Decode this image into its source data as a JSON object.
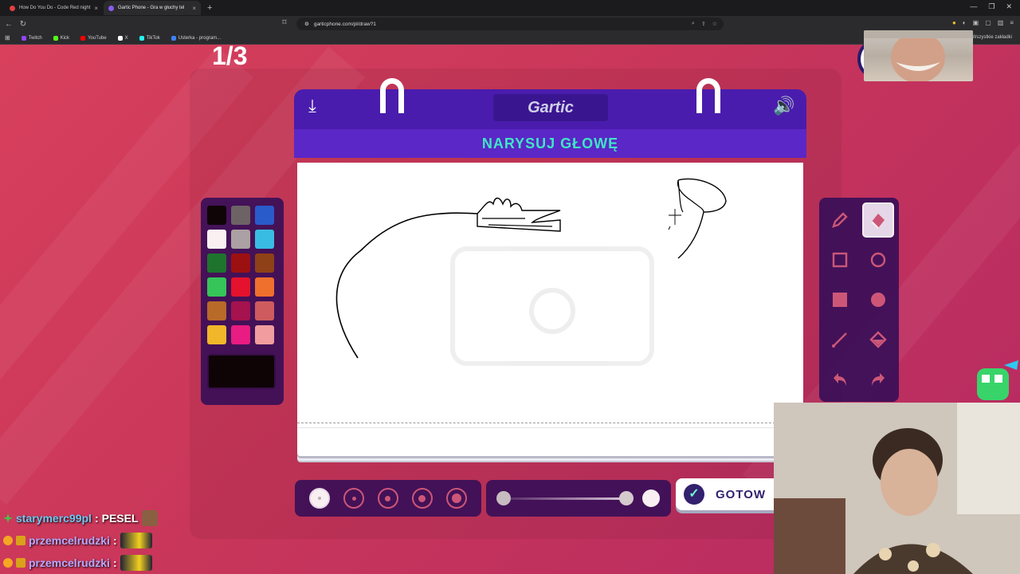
{
  "browser": {
    "tabs": [
      {
        "label": "How Do You Do - Code Red night",
        "active": false,
        "color": "#e34040"
      },
      {
        "label": "Gartic Phone - Gra w głuchy tel",
        "active": true,
        "color": "#8a5cf0"
      }
    ],
    "new_tab": "+",
    "url": "garticphone.com/pl/draw?1",
    "bookmarks": [
      {
        "label": "Twitch",
        "color": "#9146ff"
      },
      {
        "label": "Kick",
        "color": "#53fc18"
      },
      {
        "label": "YouTube",
        "color": "#ff0000"
      },
      {
        "label": "X",
        "color": "#ffffff"
      },
      {
        "label": "TikTok",
        "color": "#25f4ee"
      },
      {
        "label": "Usterka - program...",
        "color": "#3b82f6"
      }
    ],
    "bookmarks_right": "Wszystkie zakładki"
  },
  "game": {
    "round": "1/3",
    "logo": "Gartic",
    "prompt": "NARYSUJ GŁOWĘ",
    "palette": [
      "#000000",
      "#666666",
      "#1d5fd6",
      "#ffffff",
      "#aaaaaa",
      "#2ec8f0",
      "#117a2a",
      "#9a0d0d",
      "#8a4311",
      "#2ad25a",
      "#e8102a",
      "#f4762a",
      "#b86f25",
      "#a3104e",
      "#d06060",
      "#f7c227",
      "#ec1a86",
      "#f6a6a6"
    ],
    "current_color": "#000000",
    "tools": [
      {
        "name": "pencil-icon",
        "selected": false
      },
      {
        "name": "eraser-icon",
        "selected": true
      },
      {
        "name": "rectangle-outline-icon",
        "selected": false
      },
      {
        "name": "ellipse-outline-icon",
        "selected": false
      },
      {
        "name": "rectangle-fill-icon",
        "selected": false
      },
      {
        "name": "ellipse-fill-icon",
        "selected": false
      },
      {
        "name": "line-icon",
        "selected": false
      },
      {
        "name": "fill-bucket-icon",
        "selected": false
      },
      {
        "name": "undo-icon",
        "selected": false
      },
      {
        "name": "redo-icon",
        "selected": false
      }
    ],
    "brush_sizes": [
      2,
      4,
      6,
      8,
      10
    ],
    "selected_size": 0,
    "done_label": "GOTOW"
  },
  "chat": [
    {
      "user": "starymerc99pl",
      "message": "PESEL",
      "badge_color": "#3ec94a",
      "emote": "brown"
    },
    {
      "user": "przemcelrudzki",
      "message": "",
      "badge_color": "#f5a623",
      "emote": "car"
    },
    {
      "user": "przemcelrudzki",
      "message": "",
      "badge_color": "#f5a623",
      "emote": "car"
    }
  ]
}
